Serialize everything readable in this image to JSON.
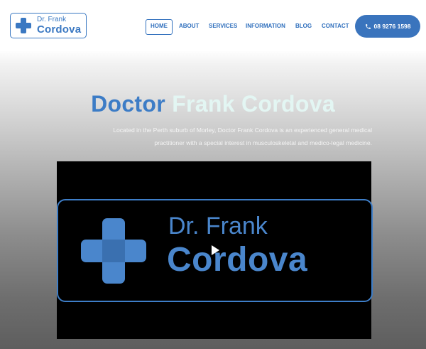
{
  "header": {
    "logo": {
      "line1": "Dr. Frank",
      "line2": "Cordova"
    },
    "nav": [
      "HOME",
      "ABOUT",
      "SERVICES",
      "INFORMATION",
      "BLOG",
      "CONTACT"
    ],
    "active_nav": "HOME",
    "phone": "08 9276 1598"
  },
  "hero": {
    "title_part1": "Doctor",
    "title_part2": "Frank Cordova",
    "subtitle_line1": "Located in the Perth suburb of Morley, Doctor Frank Cordova is an experienced general medical",
    "subtitle_line2": "practitioner with a special interest in musculoskeletal and medico-legal medicine."
  },
  "video": {
    "brand_line1": "Dr. Frank",
    "brand_line2": "Cordova"
  },
  "colors": {
    "brand_blue": "#3a78c2",
    "title_light": "#e3f6f3"
  },
  "icons": {
    "logo": "medical-cross-icon",
    "phone": "phone-icon",
    "play": "play-icon"
  }
}
